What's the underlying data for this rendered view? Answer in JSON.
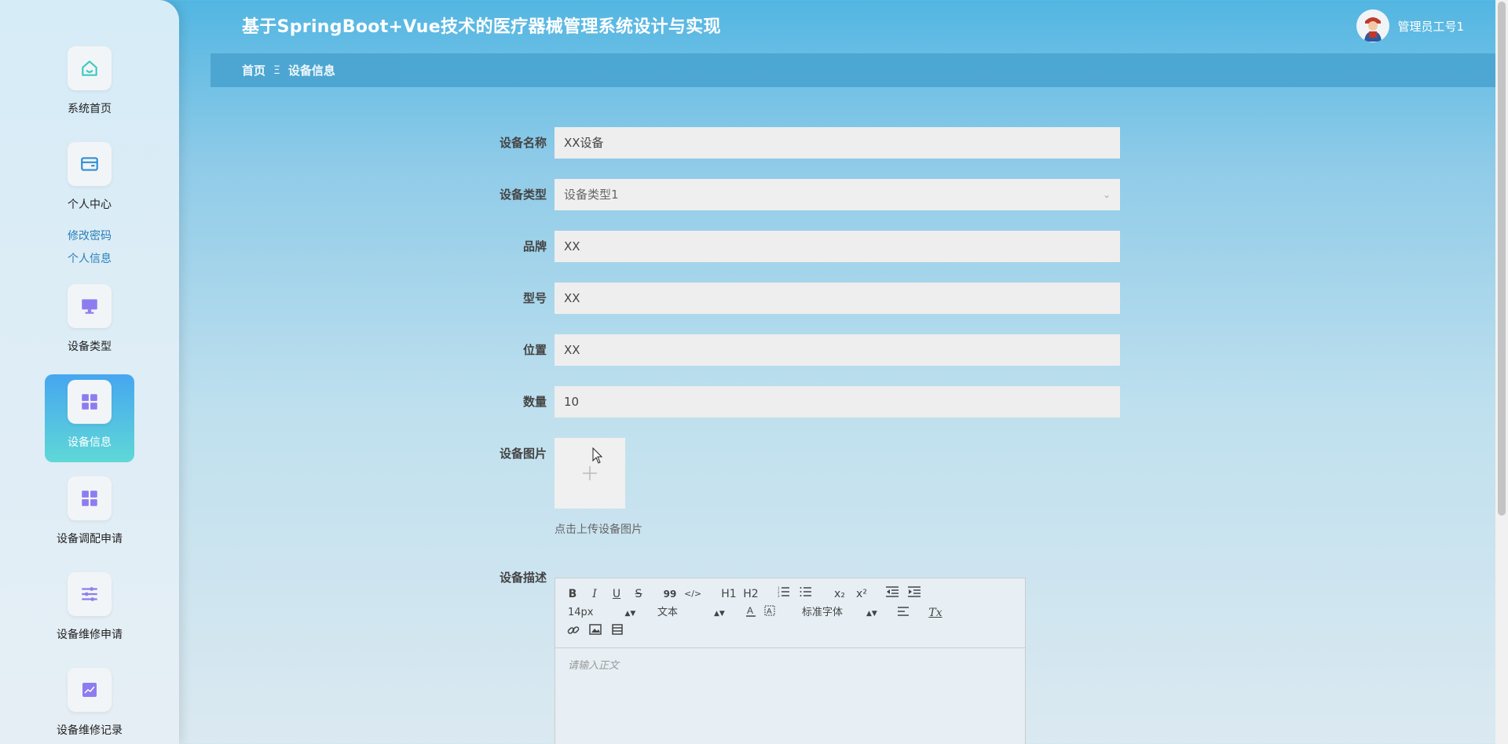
{
  "header": {
    "title": "基于SpringBoot+Vue技术的医疗器械管理系统设计与实现",
    "user_name": "管理员工号1"
  },
  "breadcrumb": {
    "home": "首页",
    "separator": "Ξ",
    "current": "设备信息"
  },
  "sidebar": {
    "items": [
      {
        "label": "系统首页",
        "icon": "home-icon"
      },
      {
        "label": "个人中心",
        "icon": "wallet-icon"
      },
      {
        "label": "设备类型",
        "icon": "monitor-icon"
      },
      {
        "label": "设备信息",
        "icon": "grid-icon",
        "active": true
      },
      {
        "label": "设备调配申请",
        "icon": "grid-icon"
      },
      {
        "label": "设备维修申请",
        "icon": "sliders-icon"
      },
      {
        "label": "设备维修记录",
        "icon": "chart-icon"
      }
    ],
    "sub_links": [
      "修改密码",
      "个人信息"
    ]
  },
  "form": {
    "name_label": "设备名称",
    "name_value": "XX设备",
    "type_label": "设备类型",
    "type_value": "设备类型1",
    "brand_label": "品牌",
    "brand_value": "XX",
    "model_label": "型号",
    "model_value": "XX",
    "location_label": "位置",
    "location_value": "XX",
    "quantity_label": "数量",
    "quantity_value": "10",
    "image_label": "设备图片",
    "upload_hint": "点击上传设备图片",
    "desc_label": "设备描述"
  },
  "editor": {
    "placeholder": "请输入正文",
    "font_size": "14px",
    "heading": "文本",
    "font_family": "标准字体",
    "h1": "H1",
    "h2": "H2",
    "bold": "B",
    "italic": "I",
    "underline": "U",
    "strike": "S",
    "quote": "99",
    "code": "</>",
    "sub": "x₂",
    "sup": "x²",
    "clean": "Tx"
  },
  "colors": {
    "accent": "#46a6f0",
    "accent2": "#5fd8d6",
    "icon_purple": "#8d7cf0",
    "icon_teal": "#3fc9c0"
  }
}
